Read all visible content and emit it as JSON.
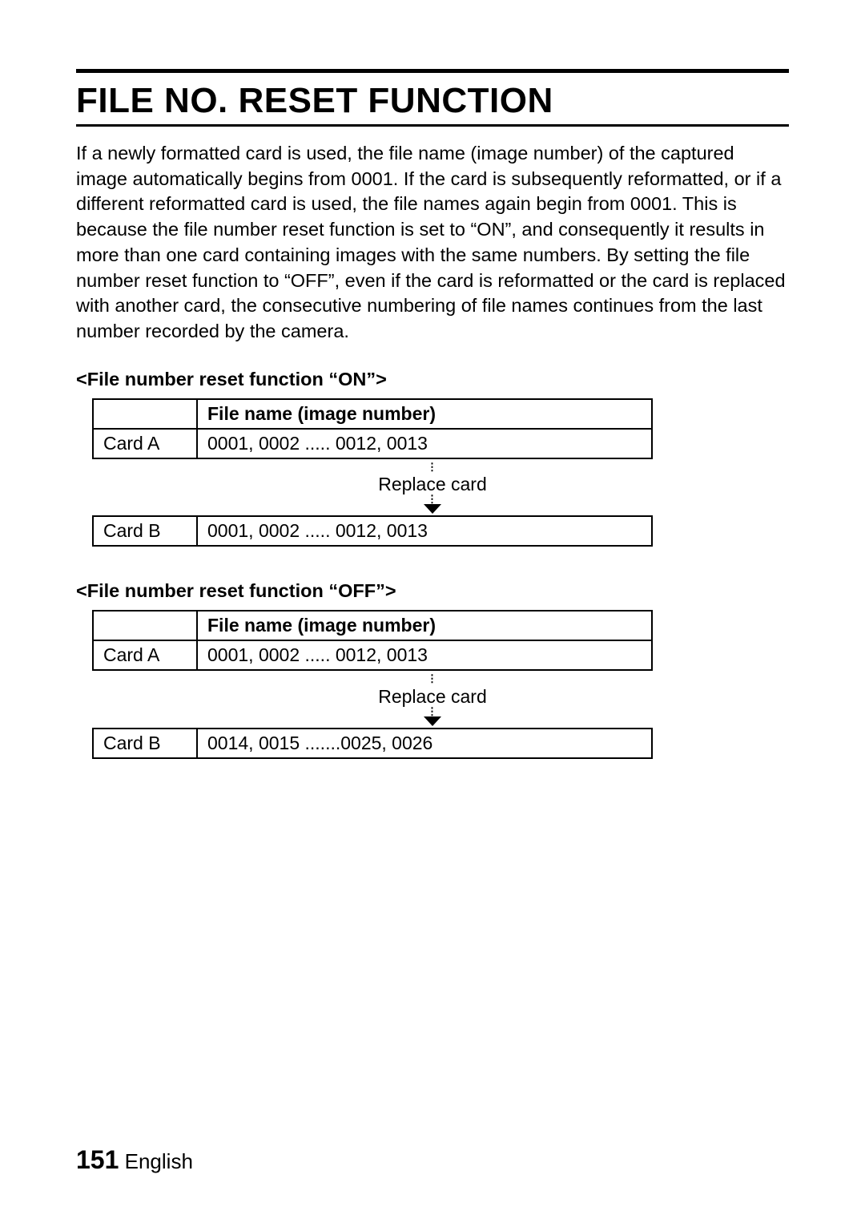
{
  "title": "FILE NO. RESET FUNCTION",
  "body": "If a newly formatted card is used, the file name (image number) of the captured image automatically begins from 0001. If the card is subsequently reformatted, or if a different reformatted card is used, the file names again begin from 0001. This is because the file number reset function is set to “ON”, and consequently it results in more than one card containing images with the same numbers. By setting the file number reset function to “OFF”, even if the card is reformatted or the card is replaced with another card, the consecutive numbering of file names continues from the last number recorded by the camera.",
  "section_on": {
    "label": "<File number reset function “ON”>",
    "header": "File name (image number)",
    "rowA_label": "Card A",
    "rowA_value": "0001, 0002 ..... 0012, 0013",
    "transition": "Replace card",
    "rowB_label": "Card B",
    "rowB_value": "0001, 0002 ..... 0012, 0013"
  },
  "section_off": {
    "label": "<File number reset function “OFF”>",
    "header": "File name (image number)",
    "rowA_label": "Card A",
    "rowA_value": "0001, 0002 ..... 0012, 0013",
    "transition": "Replace card",
    "rowB_label": "Card B",
    "rowB_value": "0014, 0015 .......0025, 0026"
  },
  "footer": {
    "page_number": "151",
    "language": "English"
  }
}
